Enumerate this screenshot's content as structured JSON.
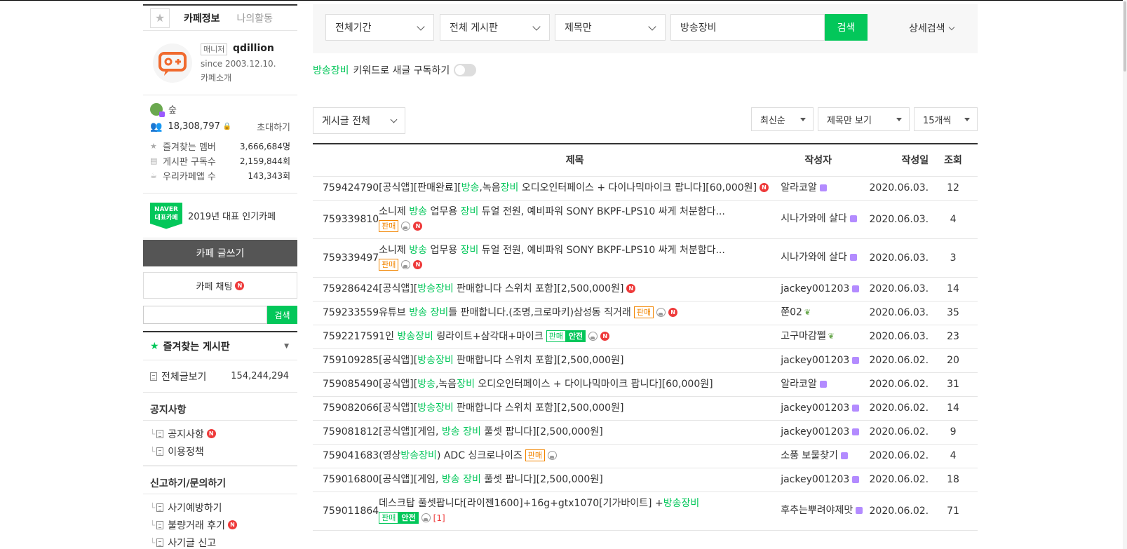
{
  "sidebar": {
    "tabs": {
      "cafe_info": "카페정보",
      "my_activity": "나의활동"
    },
    "profile": {
      "manager_badge": "매니저",
      "manager_name": "qdillion",
      "since": "since 2003.12.10.",
      "intro": "카페소개"
    },
    "stats": {
      "level": "숲",
      "members": "18,308,797",
      "invite": "초대하기",
      "fav_members_label": "즐겨찾는 멤버",
      "fav_members_value": "3,666,684명",
      "board_subs_label": "게시판 구독수",
      "board_subs_value": "2,159,844회",
      "app_label": "우리카페앱 수",
      "app_value": "143,343회"
    },
    "popular": {
      "badge_line1": "NAVER",
      "badge_line2": "대표카페",
      "text": "2019년 대표 인기카페"
    },
    "write_button": "카페 글쓰기",
    "chat_button": "카페 채팅",
    "search_button": "검색",
    "fav_board_title": "즐겨찾는 게시판",
    "all_posts_label": "전체글보기",
    "all_posts_count": "154,244,294",
    "groups": [
      {
        "title": "공지사항",
        "items": [
          {
            "label": "공지사항",
            "new": "N"
          },
          {
            "label": "이용정책",
            "new": ""
          }
        ]
      },
      {
        "title": "신고하기/문의하기",
        "items": [
          {
            "label": "사기예방하기",
            "new": ""
          },
          {
            "label": "불량거래 후기",
            "new": "N"
          },
          {
            "label": "사기글 신고",
            "new": ""
          }
        ]
      }
    ]
  },
  "search": {
    "period": "전체기간",
    "board": "전체 게시판",
    "scope": "제목만",
    "query": "방송장비",
    "button": "검색",
    "advanced": "상세검색"
  },
  "subscribe": {
    "keyword": "방송장비",
    "text": "키워드로 새글 구독하기"
  },
  "filters": {
    "board_filter": "게시글 전체",
    "sort": "최신순",
    "view": "제목만 보기",
    "per_page": "15개씩"
  },
  "table": {
    "headers": {
      "title": "제목",
      "author": "작성자",
      "date": "작성일",
      "views": "조회"
    },
    "rows": [
      {
        "id": "759424790",
        "parts": [
          [
            "[공식앱][판매완료][",
            0
          ],
          [
            "방송",
            1
          ],
          [
            ",녹음",
            0
          ],
          [
            "장비",
            1
          ],
          [
            " 오디오인터페이스 + 다이나믹마이크 팝니다][60,000원]",
            0
          ]
        ],
        "tags": [
          "N"
        ],
        "author": "알라코알",
        "author_icon": "lvl",
        "date": "2020.06.03.",
        "views": "12"
      },
      {
        "id": "759339810",
        "parts": [
          [
            "소니제 ",
            0
          ],
          [
            "방송",
            1
          ],
          [
            " 업무용 ",
            0
          ],
          [
            "장비",
            1
          ],
          [
            " 듀얼 전원, 예비파워 SONY BKPF-LPS10 싸게 처분함다...",
            0
          ]
        ],
        "tags": [
          "br",
          "sale-first",
          "img",
          "N"
        ],
        "author": "시나가와에 살다",
        "author_icon": "lvl",
        "date": "2020.06.03.",
        "views": "4"
      },
      {
        "id": "759339497",
        "parts": [
          [
            "소니제 ",
            0
          ],
          [
            "방송",
            1
          ],
          [
            " 업무용 ",
            0
          ],
          [
            "장비",
            1
          ],
          [
            " 듀얼 전원, 예비파워 SONY BKPF-LPS10 싸게 처분함다...",
            0
          ]
        ],
        "tags": [
          "br",
          "sale-first",
          "img",
          "N"
        ],
        "author": "시나가와에 살다",
        "author_icon": "lvl",
        "date": "2020.06.03.",
        "views": "3"
      },
      {
        "id": "759286424",
        "parts": [
          [
            "[공식앱][",
            0
          ],
          [
            "방송장비",
            1
          ],
          [
            " 판매합니다 스위치 포함][2,500,000원]",
            0
          ]
        ],
        "tags": [
          "N"
        ],
        "author": "jackey001203",
        "author_icon": "lvl",
        "date": "2020.06.03.",
        "views": "14"
      },
      {
        "id": "759233559",
        "parts": [
          [
            "유튜브 ",
            0
          ],
          [
            "방송",
            1
          ],
          [
            " ",
            0
          ],
          [
            "장비",
            1
          ],
          [
            "들 판매합니다.(조명,크로마키)삼성동 직거래",
            0
          ]
        ],
        "tags": [
          "sale",
          "img",
          "N"
        ],
        "author": "쭌02",
        "author_icon": "sprout",
        "date": "2020.06.03.",
        "views": "35"
      },
      {
        "id": "759221759",
        "parts": [
          [
            "1인 ",
            0
          ],
          [
            "방송장비",
            1
          ],
          [
            " 링라이트+삼각대+마이크",
            0
          ]
        ],
        "tags": [
          "sale-green",
          "safe",
          "img",
          "N"
        ],
        "author": "고구마감쩰",
        "author_icon": "sprout",
        "date": "2020.06.03.",
        "views": "23"
      },
      {
        "id": "759109285",
        "parts": [
          [
            "[공식앱][",
            0
          ],
          [
            "방송장비",
            1
          ],
          [
            " 판매합니다 스위치 포함][2,500,000원]",
            0
          ]
        ],
        "tags": [],
        "author": "jackey001203",
        "author_icon": "lvl",
        "date": "2020.06.02.",
        "views": "20"
      },
      {
        "id": "759085490",
        "parts": [
          [
            "[공식앱][",
            0
          ],
          [
            "방송",
            1
          ],
          [
            ",녹음",
            0
          ],
          [
            "장비",
            1
          ],
          [
            " 오디오인터페이스 + 다이나믹마이크 팝니다][60,000원]",
            0
          ]
        ],
        "tags": [],
        "author": "알라코알",
        "author_icon": "lvl",
        "date": "2020.06.02.",
        "views": "31"
      },
      {
        "id": "759082066",
        "parts": [
          [
            "[공식앱][",
            0
          ],
          [
            "방송장비",
            1
          ],
          [
            " 판매합니다 스위치 포함][2,500,000원]",
            0
          ]
        ],
        "tags": [],
        "author": "jackey001203",
        "author_icon": "lvl",
        "date": "2020.06.02.",
        "views": "14"
      },
      {
        "id": "759081812",
        "parts": [
          [
            "[공식앱][게임, ",
            0
          ],
          [
            "방송",
            1
          ],
          [
            " ",
            0
          ],
          [
            "장비",
            1
          ],
          [
            " 풀셋 팝니다][2,500,000원]",
            0
          ]
        ],
        "tags": [],
        "author": "jackey001203",
        "author_icon": "lvl",
        "date": "2020.06.02.",
        "views": "9"
      },
      {
        "id": "759041683",
        "parts": [
          [
            "(영상",
            0
          ],
          [
            "방송장비",
            1
          ],
          [
            ") ADC 싱크로나이즈",
            0
          ]
        ],
        "tags": [
          "sale",
          "img"
        ],
        "author": "소풍 보물찾기",
        "author_icon": "lvl",
        "date": "2020.06.02.",
        "views": "4"
      },
      {
        "id": "759016800",
        "parts": [
          [
            "[공식앱][게임, ",
            0
          ],
          [
            "방송",
            1
          ],
          [
            " ",
            0
          ],
          [
            "장비",
            1
          ],
          [
            " 풀셋 팝니다][2,500,000원]",
            0
          ]
        ],
        "tags": [],
        "author": "jackey001203",
        "author_icon": "lvl",
        "date": "2020.06.02.",
        "views": "18"
      },
      {
        "id": "759011864",
        "parts": [
          [
            "데스크탑 풀셋팝니다[라이젠1600]+16g+gtx1070[기가바이트] +",
            0
          ],
          [
            "방송장비",
            1
          ]
        ],
        "tags": [
          "br",
          "sale-green-first",
          "safe",
          "img",
          "cmt"
        ],
        "comment": "[1]",
        "author": "후추는뿌려야제맛",
        "author_icon": "lvl",
        "date": "2020.06.02.",
        "views": "71"
      }
    ],
    "tag_labels": {
      "sale": "판매",
      "safe": "안전",
      "new": "N"
    }
  }
}
